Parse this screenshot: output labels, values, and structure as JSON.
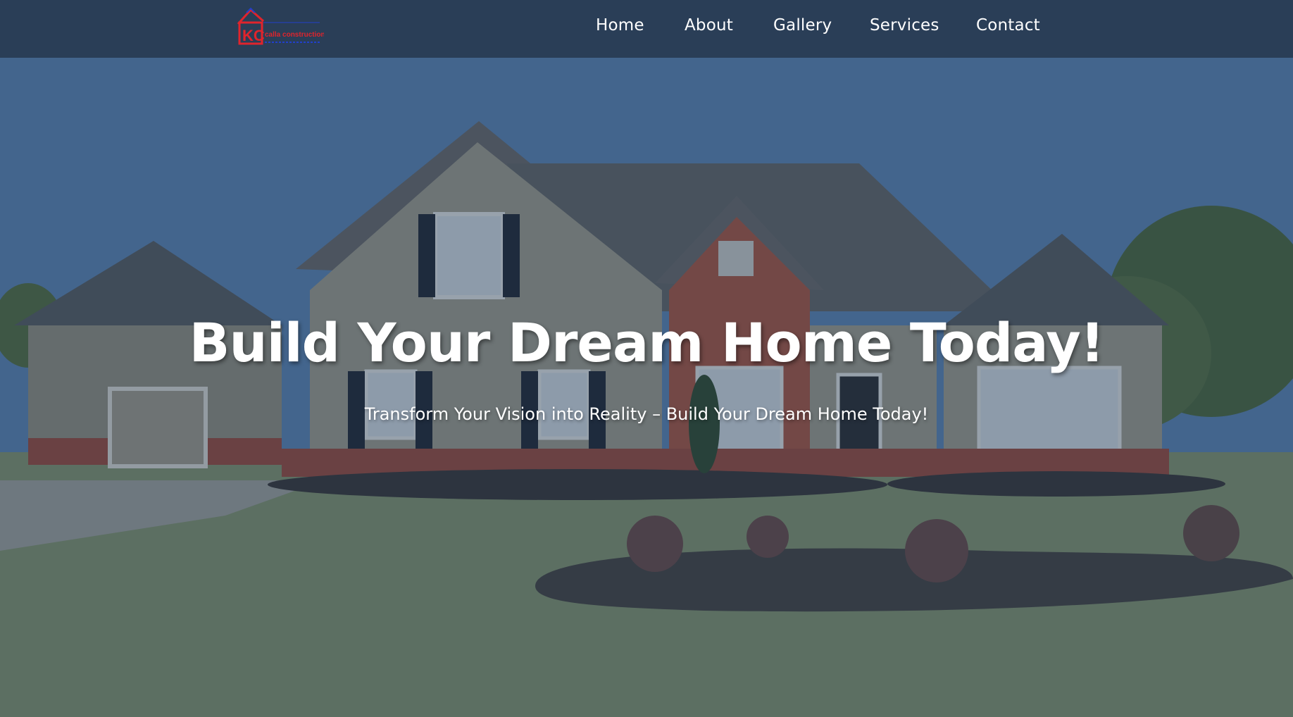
{
  "header": {
    "logo": {
      "icon": "house-logo-icon",
      "text": "KC",
      "tagline": "calla construction",
      "colors": {
        "primary": "#e0242c",
        "secondary": "#2140c9"
      }
    },
    "nav": [
      {
        "label": "Home"
      },
      {
        "label": "About"
      },
      {
        "label": "Gallery"
      },
      {
        "label": "Services"
      },
      {
        "label": "Contact"
      }
    ],
    "background_color": "#2a3e57"
  },
  "hero": {
    "title": "Build Your Dream Home Today!",
    "subtitle": "Transform Your Vision into Reality – Build Your Dream Home Today!",
    "background_image": "suburban-house-photo",
    "overlay_color": "#1c3452"
  }
}
